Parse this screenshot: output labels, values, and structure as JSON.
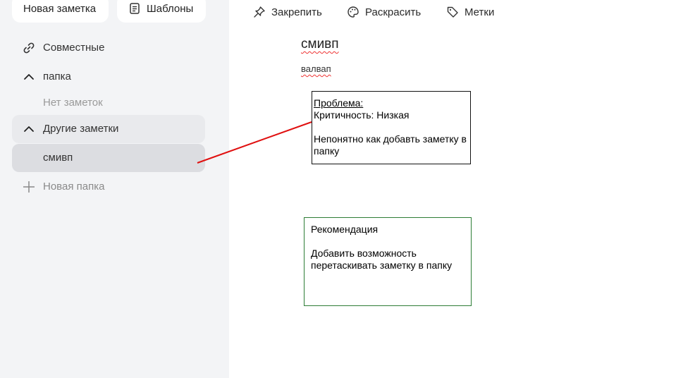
{
  "sidebar": {
    "new_note_label": "Новая заметка",
    "templates_label": "Шаблоны",
    "items": [
      {
        "label": "Совместные",
        "icon": "link-icon"
      },
      {
        "label": "папка",
        "icon": "chevron-up-icon"
      },
      {
        "label": "Нет заметок"
      },
      {
        "label": "Другие заметки",
        "icon": "chevron-up-icon"
      },
      {
        "label": "смивп"
      },
      {
        "label": "Новая папка",
        "icon": "plus-icon"
      }
    ]
  },
  "toolbar": {
    "pin_label": "Закрепить",
    "color_label": "Раскрасить",
    "tags_label": "Метки"
  },
  "note": {
    "title": "смивп",
    "body": "валвап"
  },
  "annotations": {
    "problem_heading": "Проблема:",
    "problem_severity": "Критичность: Низкая",
    "problem_text": "Непонятно как добавть заметку в папку",
    "recommendation_heading": "Рекомендация",
    "recommendation_text": "Добавить возможность перетаскивать заметку в папку",
    "problem_border": "#111111",
    "recommendation_border": "#2d7d35",
    "connector_color": "#e01010"
  }
}
